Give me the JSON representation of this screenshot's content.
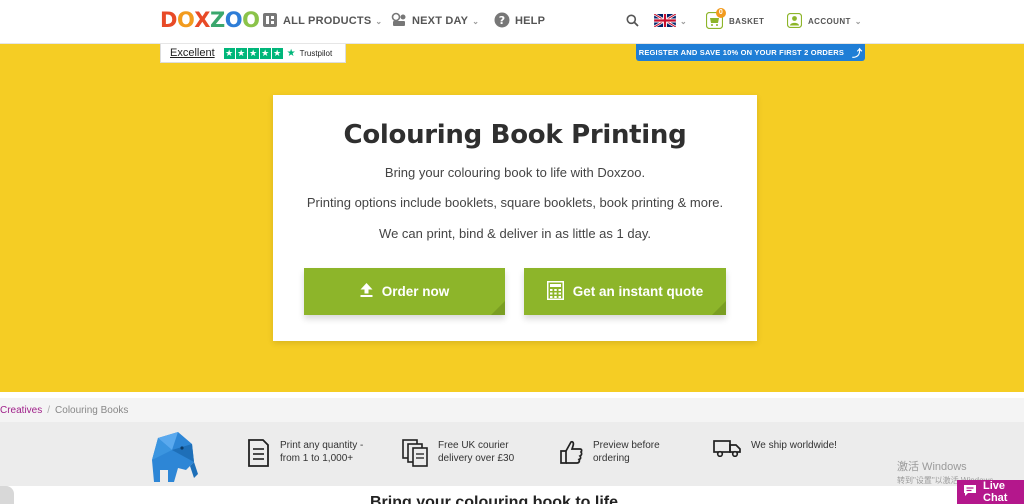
{
  "brand": {
    "logo_letters": [
      "D",
      "O",
      "X",
      "Z",
      "O",
      "O"
    ],
    "logo_colors": [
      "#e84a27",
      "#f29b1d",
      "#e84a27",
      "#3aa76d",
      "#2e7dd7",
      "#8bc34a"
    ]
  },
  "nav": {
    "all_products": "ALL PRODUCTS",
    "next_day": "NEXT DAY",
    "help": "HELP",
    "basket": "BASKET",
    "basket_count": "0",
    "account": "ACCOUNT"
  },
  "trustpilot": {
    "rating_text": "Excellent",
    "brand": "Trustpilot",
    "stars": 5,
    "star_color": "#00b67a"
  },
  "register_banner": "REGISTER AND SAVE 10% ON YOUR FIRST 2 ORDERS",
  "hero": {
    "title": "Colouring Book Printing",
    "line1": "Bring your colouring book to life with Doxzoo.",
    "line2": "Printing options include booklets, square booklets, book printing & more.",
    "line3": "We can print, bind & deliver in as little as 1 day.",
    "order_button": "Order now",
    "quote_button": "Get an instant quote",
    "background_color": "#f5cd24",
    "button_color": "#8db52a"
  },
  "breadcrumb": {
    "parent": "Creatives",
    "separator": "/",
    "current": "Colouring Books"
  },
  "features": [
    {
      "icon": "document-list-icon",
      "line1": "Print any quantity -",
      "line2": "from 1 to 1,000+"
    },
    {
      "icon": "copies-icon",
      "line1": "Free UK courier",
      "line2": "delivery over £30"
    },
    {
      "icon": "thumbs-up-icon",
      "line1": "Preview before",
      "line2": "ordering"
    },
    {
      "icon": "delivery-truck-icon",
      "line1": "We ship worldwide!",
      "line2": ""
    }
  ],
  "teaser_heading": "Bring your colouring book to life",
  "os_watermark": {
    "line1": "激活 Windows",
    "line2": "转到\"设置\"以激活 Windows。"
  },
  "live_chat": "Live Chat"
}
